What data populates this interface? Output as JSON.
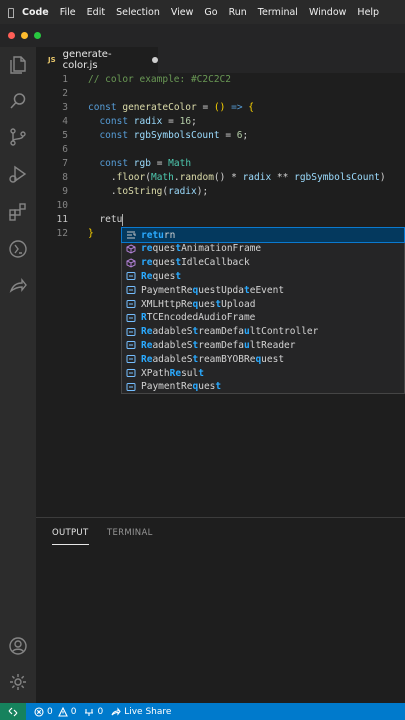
{
  "menubar": {
    "app": "Code",
    "items": [
      "File",
      "Edit",
      "Selection",
      "View",
      "Go",
      "Run",
      "Terminal",
      "Window",
      "Help"
    ]
  },
  "window": {
    "traffic_lights": [
      "#ff5f57",
      "#febc2e",
      "#28c840"
    ]
  },
  "tab": {
    "lang_badge": "JS",
    "filename": "generate-color.js"
  },
  "editor": {
    "lines": [
      {
        "n": "1",
        "html": "<span class='cmt'>// color example: #C2C2C2</span>"
      },
      {
        "n": "2",
        "html": ""
      },
      {
        "n": "3",
        "html": "<span class='kw'>const</span> <span class='fn'>generateColor</span> <span class='op'>=</span> <span class='br'>()</span> <span class='kw'>=&gt;</span> <span class='br'>{</span>"
      },
      {
        "n": "4",
        "html": "  <span class='kw'>const</span> <span class='var'>radix</span> <span class='op'>=</span> <span class='num'>16</span><span class='op'>;</span>"
      },
      {
        "n": "5",
        "html": "  <span class='kw'>const</span> <span class='var'>rgbSymbolsCount</span> <span class='op'>=</span> <span class='num'>6</span><span class='op'>;</span>"
      },
      {
        "n": "6",
        "html": ""
      },
      {
        "n": "7",
        "html": "  <span class='kw'>const</span> <span class='var'>rgb</span> <span class='op'>=</span> <span class='cls'>Math</span>"
      },
      {
        "n": "8",
        "html": "    <span class='op'>.</span><span class='fn'>floor</span><span class='op'>(</span><span class='cls'>Math</span><span class='op'>.</span><span class='fn'>random</span><span class='op'>()</span> <span class='op'>*</span> <span class='var'>radix</span> <span class='op'>**</span> <span class='var'>rgbSymbolsCount</span><span class='op'>)</span>"
      },
      {
        "n": "9",
        "html": "    <span class='op'>.</span><span class='fn'>toString</span><span class='op'>(</span><span class='var'>radix</span><span class='op'>);</span>"
      },
      {
        "n": "10",
        "html": ""
      },
      {
        "n": "11",
        "html": "  <span class='op'>retu</span><span class='cursor'></span>"
      },
      {
        "n": "12",
        "html": "<span class='br'>}</span>"
      }
    ]
  },
  "suggestions": [
    {
      "kind": "keyword",
      "html": "<b>retu</b>rn"
    },
    {
      "kind": "method",
      "html": "<b>re</b>ques<b>t</b>AnimationFrame"
    },
    {
      "kind": "method",
      "html": "<b>re</b>ques<b>t</b>IdleCallback"
    },
    {
      "kind": "class",
      "html": "<b>Re</b>ques<b>t</b>"
    },
    {
      "kind": "class",
      "html": "PaymentRe<b>q</b>uestUpda<b>t</b>eEvent"
    },
    {
      "kind": "class",
      "html": "XMLHttpRe<b>q</b>ues<b>t</b>Upload"
    },
    {
      "kind": "class",
      "html": "<b>R</b>TCEncodedAudioFrame"
    },
    {
      "kind": "class",
      "html": "<b>Re</b>adableS<b>t</b>reamDefa<b>u</b>ltController"
    },
    {
      "kind": "class",
      "html": "<b>Re</b>adableS<b>t</b>reamDefa<b>u</b>ltReader"
    },
    {
      "kind": "class",
      "html": "<b>Re</b>adableS<b>t</b>reamBYOBRe<b>q</b>uest"
    },
    {
      "kind": "class",
      "html": "XPath<b>Re</b>sul<b>t</b>"
    },
    {
      "kind": "class",
      "html": "PaymentRe<b>q</b>ues<b>t</b>"
    }
  ],
  "panel": {
    "tabs": [
      "OUTPUT",
      "TERMINAL"
    ]
  },
  "statusbar": {
    "errors": "0",
    "warnings": "0",
    "ports": "0",
    "live_server": "Live Share",
    "remote_color": "#16825d",
    "bg_color": "#007acc"
  },
  "icons": [
    "explorer-icon",
    "search-icon",
    "source-control-icon",
    "run-debug-icon",
    "extensions-icon",
    "remote-explorer-icon",
    "live-share-icon",
    "account-icon",
    "manage-gear-icon"
  ]
}
